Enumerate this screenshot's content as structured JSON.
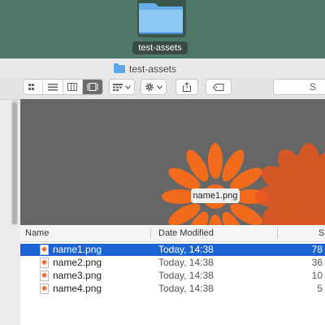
{
  "desktop": {
    "folder_label": "test-assets"
  },
  "window": {
    "title": "test-assets",
    "search_glyph": "S"
  },
  "gallery": {
    "caption": "name1.png",
    "accent_color": "#f26a1c"
  },
  "table": {
    "columns": [
      "Name",
      "Date Modified",
      "S"
    ],
    "rows": [
      {
        "name": "name1.png",
        "date": "Today, 14:38",
        "size": "78"
      },
      {
        "name": "name2.png",
        "date": "Today, 14:38",
        "size": "36"
      },
      {
        "name": "name3.png",
        "date": "Today, 14:38",
        "size": "10"
      },
      {
        "name": "name4.png",
        "date": "Today, 14:38",
        "size": "5"
      }
    ],
    "selected_row": 0,
    "selection_color": "#1c64d1"
  },
  "icons": {
    "folder": "folder-icon",
    "image_file": "png-file-icon",
    "gear": "gear-icon",
    "share": "share-icon",
    "tag": "tag-icon"
  }
}
